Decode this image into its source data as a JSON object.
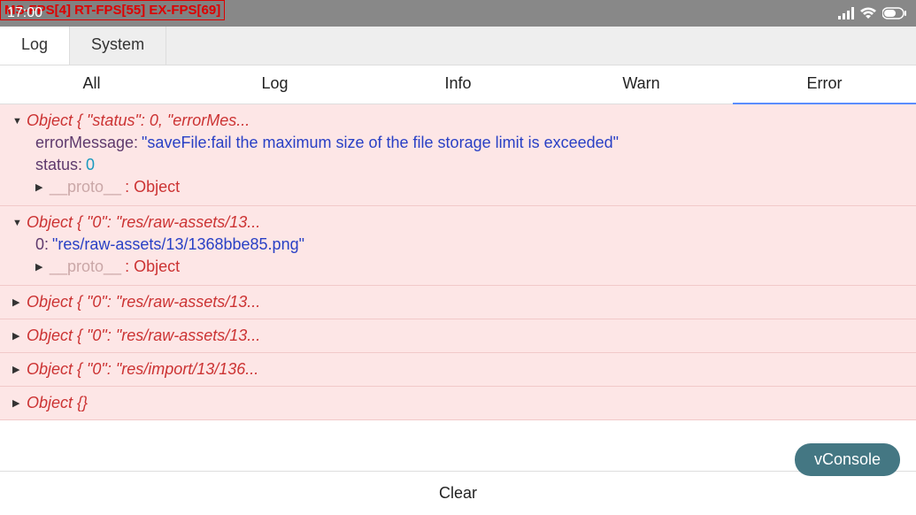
{
  "status_bar": {
    "fps_overlay": "MS-FPS[4] RT-FPS[55] EX-FPS[69]",
    "time": "17:00"
  },
  "top_tabs": {
    "log": "Log",
    "system": "System"
  },
  "filter_tabs": {
    "all": "All",
    "log": "Log",
    "info": "Info",
    "warn": "Warn",
    "error": "Error"
  },
  "entries": [
    {
      "header": "Object { \"status\": 0, \"errorMes...",
      "expanded": true,
      "props": [
        {
          "key": "errorMessage: ",
          "val": "\"saveFile:fail the maximum size of the file storage limit is exceeded\"",
          "type": "str"
        },
        {
          "key": "status: ",
          "val": "0",
          "type": "num"
        }
      ],
      "proto_key": "__proto__",
      "proto_val": ": Object"
    },
    {
      "header": "Object { \"0\": \"res/raw-assets/13...",
      "expanded": true,
      "props": [
        {
          "key": "0: ",
          "val": "\"res/raw-assets/13/1368bbe85.png\"",
          "type": "str"
        }
      ],
      "proto_key": "__proto__",
      "proto_val": ": Object"
    },
    {
      "header": "Object { \"0\": \"res/raw-assets/13...",
      "expanded": false
    },
    {
      "header": "Object { \"0\": \"res/raw-assets/13...",
      "expanded": false
    },
    {
      "header": "Object { \"0\": \"res/import/13/136...",
      "expanded": false
    },
    {
      "header": "Object {}",
      "expanded": false
    }
  ],
  "footer": {
    "clear": "Clear"
  },
  "vconsole_btn": "vConsole"
}
